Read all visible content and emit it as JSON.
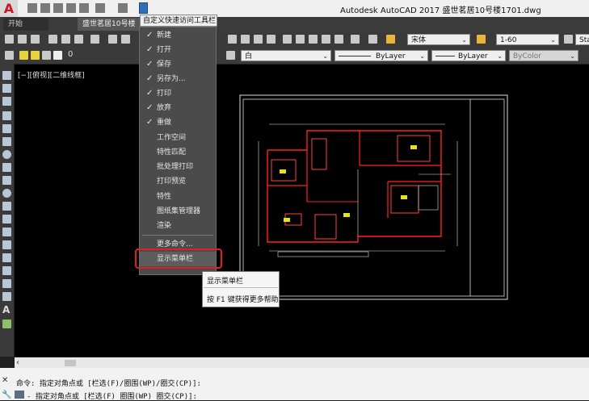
{
  "title_bar": {
    "logo": "A",
    "title": "Autodesk AutoCAD 2017    盛世茗居10号楼1701.dwg"
  },
  "tabs": [
    {
      "label": "开始"
    },
    {
      "label": "盛世茗居10号楼"
    }
  ],
  "toolbar": {
    "font_combo": "宋体",
    "scale_combo": "1-60",
    "style_partial": "Sta",
    "layer_name": "0",
    "color_combo": "白",
    "linetype_combo": "ByLayer",
    "lineweight_combo": "ByLayer",
    "plotstyle_combo": "ByColor"
  },
  "viewport": {
    "label": "[−][俯视][二维线框]"
  },
  "qat_menu": {
    "header": "自定义快速访问工具栏",
    "items": [
      {
        "label": "新建",
        "checked": true
      },
      {
        "label": "打开",
        "checked": true
      },
      {
        "label": "保存",
        "checked": true
      },
      {
        "label": "另存为...",
        "checked": true
      },
      {
        "label": "打印",
        "checked": true
      },
      {
        "label": "放弃",
        "checked": true
      },
      {
        "label": "重做",
        "checked": true
      },
      {
        "label": "工作空间",
        "checked": false
      },
      {
        "label": "特性匹配",
        "checked": false
      },
      {
        "label": "批处理打印",
        "checked": false
      },
      {
        "label": "打印预览",
        "checked": false
      },
      {
        "label": "特性",
        "checked": false
      },
      {
        "label": "图纸集管理器",
        "checked": false
      },
      {
        "label": "渲染",
        "checked": false
      },
      {
        "label": "更多命令...",
        "checked": false
      },
      {
        "label": "显示菜单栏",
        "checked": false
      }
    ],
    "check_glyph": "✓"
  },
  "tooltip": {
    "title": "显示菜单栏",
    "help": "按 F1 键获得更多帮助"
  },
  "command": {
    "history": "命令:  指定对角点或 [栏选(F)/圈围(WP)/圈交(CP)]:",
    "prompt": "- 指定对角点或 [栏选(F) 圈围(WP) 圈交(CP)]:"
  },
  "colors": {
    "highlight_box": "#e02020",
    "drawing_walls": "#ff2020",
    "drawing_lines": "#ffffff"
  }
}
